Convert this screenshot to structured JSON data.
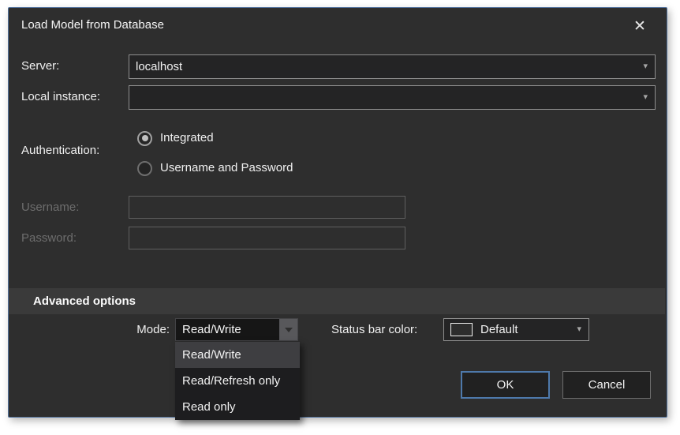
{
  "window": {
    "title": "Load Model from Database",
    "close_icon": "✕"
  },
  "icons": {
    "dropdown_chevron": "▾"
  },
  "form": {
    "server": {
      "label": "Server:",
      "value": "localhost"
    },
    "local_instance": {
      "label": "Local instance:",
      "value": ""
    },
    "authentication": {
      "label": "Authentication:",
      "options": [
        {
          "label": "Integrated",
          "selected": true
        },
        {
          "label": "Username and Password",
          "selected": false
        }
      ]
    },
    "username": {
      "label": "Username:",
      "value": "",
      "disabled": true
    },
    "password": {
      "label": "Password:",
      "value": "",
      "disabled": true
    }
  },
  "advanced": {
    "header": "Advanced options",
    "mode": {
      "label": "Mode:",
      "value": "Read/Write",
      "dropdown_open": true,
      "options": [
        "Read/Write",
        "Read/Refresh only",
        "Read only"
      ],
      "highlighted_option": "Read/Write"
    },
    "status_bar_color": {
      "label": "Status bar color:",
      "value": "Default",
      "swatch": "color-swatch-default"
    }
  },
  "actions": {
    "ok": "OK",
    "cancel": "Cancel"
  },
  "colors": {
    "dialog_background": "#2e2e2e",
    "dialog_border": "#55749e",
    "advanced_strip": "#3a3a3a",
    "field_background": "#242425",
    "field_border": "#8f8f8f",
    "text": "#f2f2f2",
    "disabled_text": "#6d6d6d",
    "ok_button_border": "#4e79ab",
    "dropdown_highlight": "#3e3e41"
  }
}
